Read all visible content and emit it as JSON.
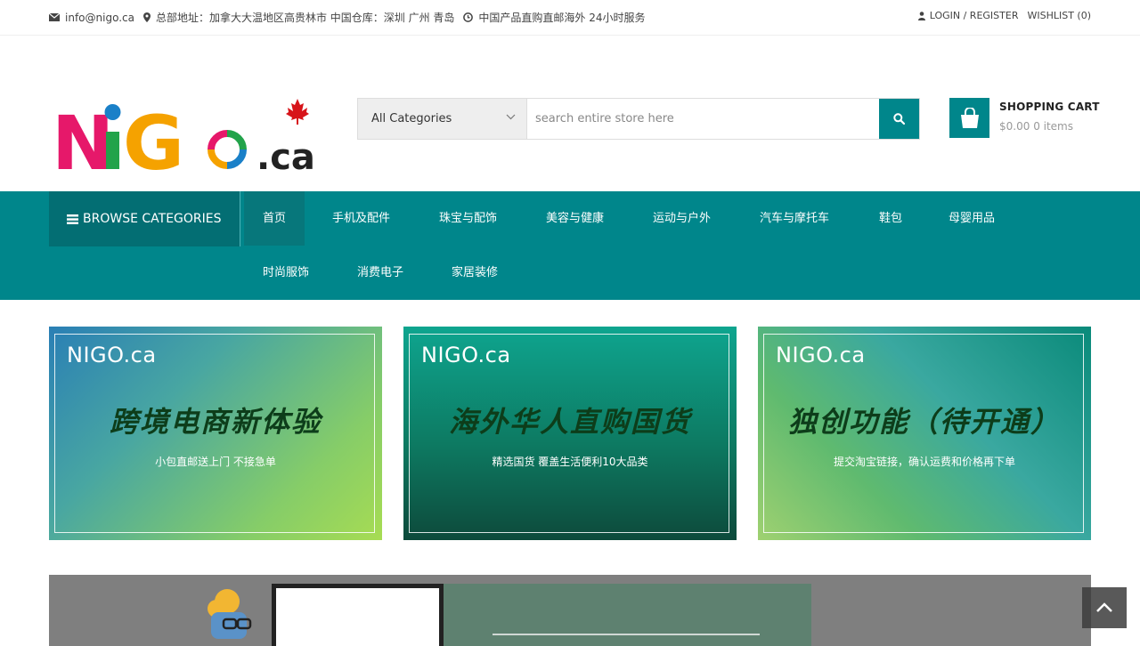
{
  "topbar": {
    "email": "info@nigo.ca",
    "address": "总部地址：加拿大大温地区高贵林市 中国仓库：深圳 广州 青岛",
    "service": "中国产品直购直邮海外 24小时服务",
    "login": "LOGIN / REGISTER",
    "wishlist": "WISHLIST (0)"
  },
  "logo": {
    "letters": [
      "N",
      "i",
      "G",
      "o"
    ],
    "suffix": ".ca",
    "maple_leaf": "maple-leaf-icon"
  },
  "search": {
    "category_selected": "All Categories",
    "placeholder": "search entire store here",
    "button_icon": "search-icon"
  },
  "cart": {
    "title": "SHOPPING CART",
    "total": "$0.00",
    "items": "0 items"
  },
  "nav": {
    "browse_label": "BROWSE CATEGORIES",
    "items": [
      "首页",
      "手机及配件",
      "珠宝与配饰",
      "美容与健康",
      "运动与户外",
      "汽车与摩托车",
      "鞋包",
      "母婴用品",
      "时尚服饰",
      "消费电子",
      "家居装修"
    ]
  },
  "banners": [
    {
      "brand": "NIGO.ca",
      "slogan": "跨境电商新体验",
      "sub": "小包直邮送上门  不接急单"
    },
    {
      "brand": "NIGO.ca",
      "slogan": "海外华人直购国货",
      "sub": "精选国货 覆盖生活便利10大品类"
    },
    {
      "brand": "NIGO.ca",
      "slogan": "独创功能（待开通）",
      "sub": "提交淘宝链接，确认运费和价格再下单"
    }
  ],
  "colors": {
    "primary": "#00868b",
    "primary_dark": "#036e73",
    "logo_n": "#e6186a",
    "logo_i": "#22a34a",
    "logo_g": "#f5a200"
  }
}
